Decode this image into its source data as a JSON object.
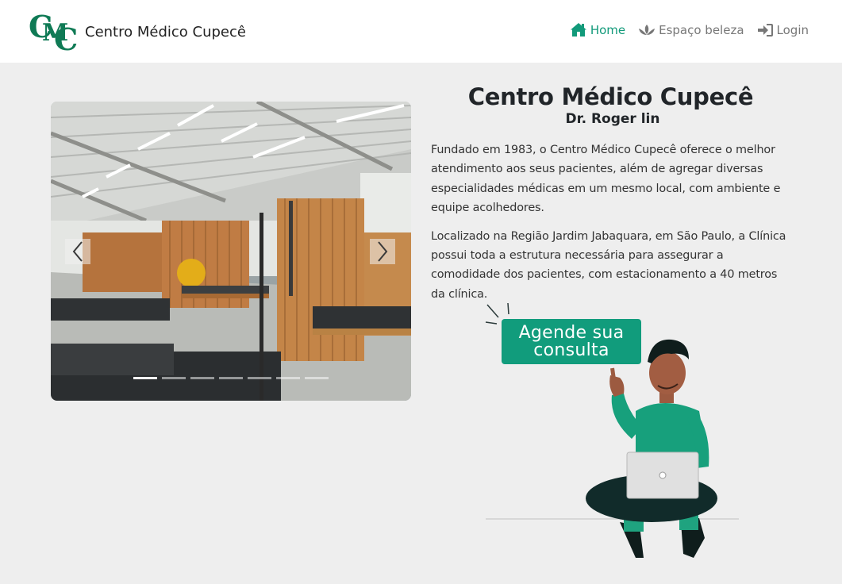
{
  "navbar": {
    "brand_name": "Centro Médico Cupecê",
    "logo_text": "CMC",
    "items": [
      {
        "label": "Home",
        "icon": "home-icon",
        "active": true
      },
      {
        "label": "Espaço beleza",
        "icon": "lotus-icon",
        "active": false
      },
      {
        "label": "Login",
        "icon": "sign-in-icon",
        "active": false
      }
    ]
  },
  "carousel": {
    "slide_count": 7,
    "active_index": 0
  },
  "main": {
    "title": "Centro Médico Cupecê",
    "subtitle": "Dr. Roger lin",
    "paragraphs": [
      "Fundado em 1983, o Centro Médico Cupecê oferece o melhor atendimento aos seus pacientes, além de agregar diversas especialidades médicas em um mesmo local, com ambiente e equipe acolhedores.",
      "Localizado na Região Jardim Jabaquara, em São Paulo, a Clínica possui toda a estrutura necessária para assegurar a comodidade dos pacientes, com estacionamento a 40 metros da clínica."
    ],
    "cta_line1": "Agende sua",
    "cta_line2": "consulta"
  },
  "colors": {
    "accent": "#129a7a",
    "background": "#eeeeee",
    "navbar": "#ffffff"
  }
}
